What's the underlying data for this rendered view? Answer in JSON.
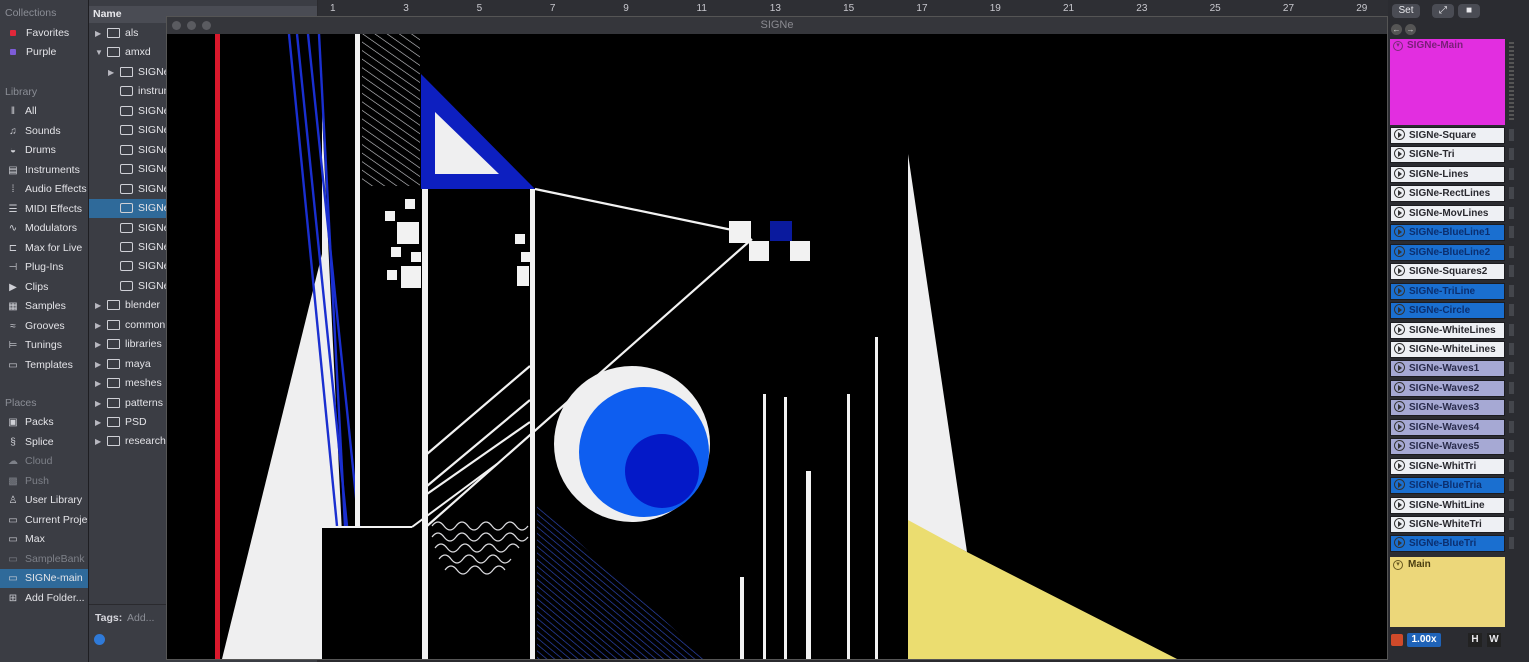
{
  "sidebar": {
    "collections_title": "Collections",
    "collections": [
      {
        "label": "Favorites",
        "color": "#e0283a"
      },
      {
        "label": "Purple",
        "color": "#7d5cd8"
      }
    ],
    "library_title": "Library",
    "library": [
      {
        "label": "All",
        "icon": "library-icon"
      },
      {
        "label": "Sounds",
        "icon": "note-icon"
      },
      {
        "label": "Drums",
        "icon": "drum-icon"
      },
      {
        "label": "Instruments",
        "icon": "keyboard-icon"
      },
      {
        "label": "Audio Effects",
        "icon": "waveform-icon"
      },
      {
        "label": "MIDI Effects",
        "icon": "midi-icon"
      },
      {
        "label": "Modulators",
        "icon": "modulator-icon"
      },
      {
        "label": "Max for Live",
        "icon": "max-icon"
      },
      {
        "label": "Plug-Ins",
        "icon": "plugin-icon"
      },
      {
        "label": "Clips",
        "icon": "clip-icon"
      },
      {
        "label": "Samples",
        "icon": "sample-icon"
      },
      {
        "label": "Grooves",
        "icon": "groove-icon"
      },
      {
        "label": "Tunings",
        "icon": "tuning-icon"
      },
      {
        "label": "Templates",
        "icon": "template-icon"
      }
    ],
    "places_title": "Places",
    "places": [
      {
        "label": "Packs",
        "icon": "packs-icon",
        "dim": false
      },
      {
        "label": "Splice",
        "icon": "splice-icon",
        "dim": false
      },
      {
        "label": "Cloud",
        "icon": "cloud-icon",
        "dim": true
      },
      {
        "label": "Push",
        "icon": "push-icon",
        "dim": true
      },
      {
        "label": "User Library",
        "icon": "user-icon",
        "dim": false
      },
      {
        "label": "Current Project",
        "icon": "project-icon",
        "dim": false
      },
      {
        "label": "Max",
        "icon": "folder-icon",
        "dim": false
      },
      {
        "label": "SampleBank",
        "icon": "folder-icon",
        "dim": true
      },
      {
        "label": "SIGNe-main",
        "icon": "folder-icon",
        "dim": false,
        "selected": true
      },
      {
        "label": "Add Folder...",
        "icon": "add-folder-icon",
        "dim": false
      }
    ]
  },
  "files": {
    "header": "Name",
    "rows": [
      {
        "label": "als",
        "arrow": "▶",
        "indent": 0,
        "icon": "folder"
      },
      {
        "label": "amxd",
        "arrow": "▼",
        "indent": 0,
        "icon": "folder"
      },
      {
        "label": "SIGNe",
        "arrow": "▶",
        "indent": 1,
        "icon": "folder"
      },
      {
        "label": "instrument",
        "arrow": "",
        "indent": 1,
        "icon": "device"
      },
      {
        "label": "SIGNe",
        "arrow": "",
        "indent": 1,
        "icon": "device"
      },
      {
        "label": "SIGNe",
        "arrow": "",
        "indent": 1,
        "icon": "device"
      },
      {
        "label": "SIGNe",
        "arrow": "",
        "indent": 1,
        "icon": "device"
      },
      {
        "label": "SIGNe",
        "arrow": "",
        "indent": 1,
        "icon": "device"
      },
      {
        "label": "SIGNe",
        "arrow": "",
        "indent": 1,
        "icon": "device"
      },
      {
        "label": "SIGNe",
        "arrow": "",
        "indent": 1,
        "icon": "device",
        "selected": true
      },
      {
        "label": "SIGNe",
        "arrow": "",
        "indent": 1,
        "icon": "device"
      },
      {
        "label": "SIGNe",
        "arrow": "",
        "indent": 1,
        "icon": "device"
      },
      {
        "label": "SIGNe",
        "arrow": "",
        "indent": 1,
        "icon": "device"
      },
      {
        "label": "SIGNe",
        "arrow": "",
        "indent": 1,
        "icon": "device"
      },
      {
        "label": "blender",
        "arrow": "▶",
        "indent": 0,
        "icon": "folder"
      },
      {
        "label": "common",
        "arrow": "▶",
        "indent": 0,
        "icon": "folder"
      },
      {
        "label": "libraries",
        "arrow": "▶",
        "indent": 0,
        "icon": "folder"
      },
      {
        "label": "maya",
        "arrow": "▶",
        "indent": 0,
        "icon": "folder"
      },
      {
        "label": "meshes",
        "arrow": "▶",
        "indent": 0,
        "icon": "folder"
      },
      {
        "label": "patterns",
        "arrow": "▶",
        "indent": 0,
        "icon": "folder"
      },
      {
        "label": "PSD",
        "arrow": "▶",
        "indent": 0,
        "icon": "folder"
      },
      {
        "label": "research",
        "arrow": "▶",
        "indent": 0,
        "icon": "folder"
      }
    ],
    "tags_label": "Tags:",
    "tags_placeholder": "Add..."
  },
  "ruler": {
    "ticks": [
      "1",
      "3",
      "5",
      "7",
      "9",
      "11",
      "13",
      "15",
      "17",
      "19",
      "21",
      "23",
      "25",
      "27",
      "29"
    ]
  },
  "plugin_window": {
    "title": "SIGNe"
  },
  "session": {
    "set_button": "Set",
    "track_header": "SIGNe-Main",
    "track_header_color": "#e22ee0",
    "clips": [
      {
        "label": "SIGNe-Square",
        "style": "w"
      },
      {
        "label": "SIGNe-Tri",
        "style": "w"
      },
      {
        "label": "SIGNe-Lines",
        "style": "w"
      },
      {
        "label": "SIGNe-RectLines",
        "style": "w"
      },
      {
        "label": "SIGNe-MovLines",
        "style": "w"
      },
      {
        "label": "SIGNe-BlueLine1",
        "style": "b"
      },
      {
        "label": "SIGNe-BlueLine2",
        "style": "b"
      },
      {
        "label": "SIGNe-Squares2",
        "style": "w"
      },
      {
        "label": "SIGNe-TriLine",
        "style": "b"
      },
      {
        "label": "SIGNe-Circle",
        "style": "b"
      },
      {
        "label": "SIGNe-WhiteLines",
        "style": "w"
      },
      {
        "label": "SIGNe-WhiteLines",
        "style": "w"
      },
      {
        "label": "SIGNe-Waves1",
        "style": "l"
      },
      {
        "label": "SIGNe-Waves2",
        "style": "l"
      },
      {
        "label": "SIGNe-Waves3",
        "style": "l"
      },
      {
        "label": "SIGNe-Waves4",
        "style": "l"
      },
      {
        "label": "SIGNe-Waves5",
        "style": "l"
      },
      {
        "label": "SIGNe-WhitTri",
        "style": "w"
      },
      {
        "label": "SIGNe-BlueTria",
        "style": "b"
      },
      {
        "label": "SIGNe-WhitLine",
        "style": "w"
      },
      {
        "label": "SIGNe-WhiteTri",
        "style": "w"
      },
      {
        "label": "SIGNe-BlueTri",
        "style": "b"
      }
    ],
    "main_track": "Main",
    "main_track_color": "#ecd77a",
    "zoom": "1.00x",
    "h_button": "H",
    "w_button": "W"
  }
}
